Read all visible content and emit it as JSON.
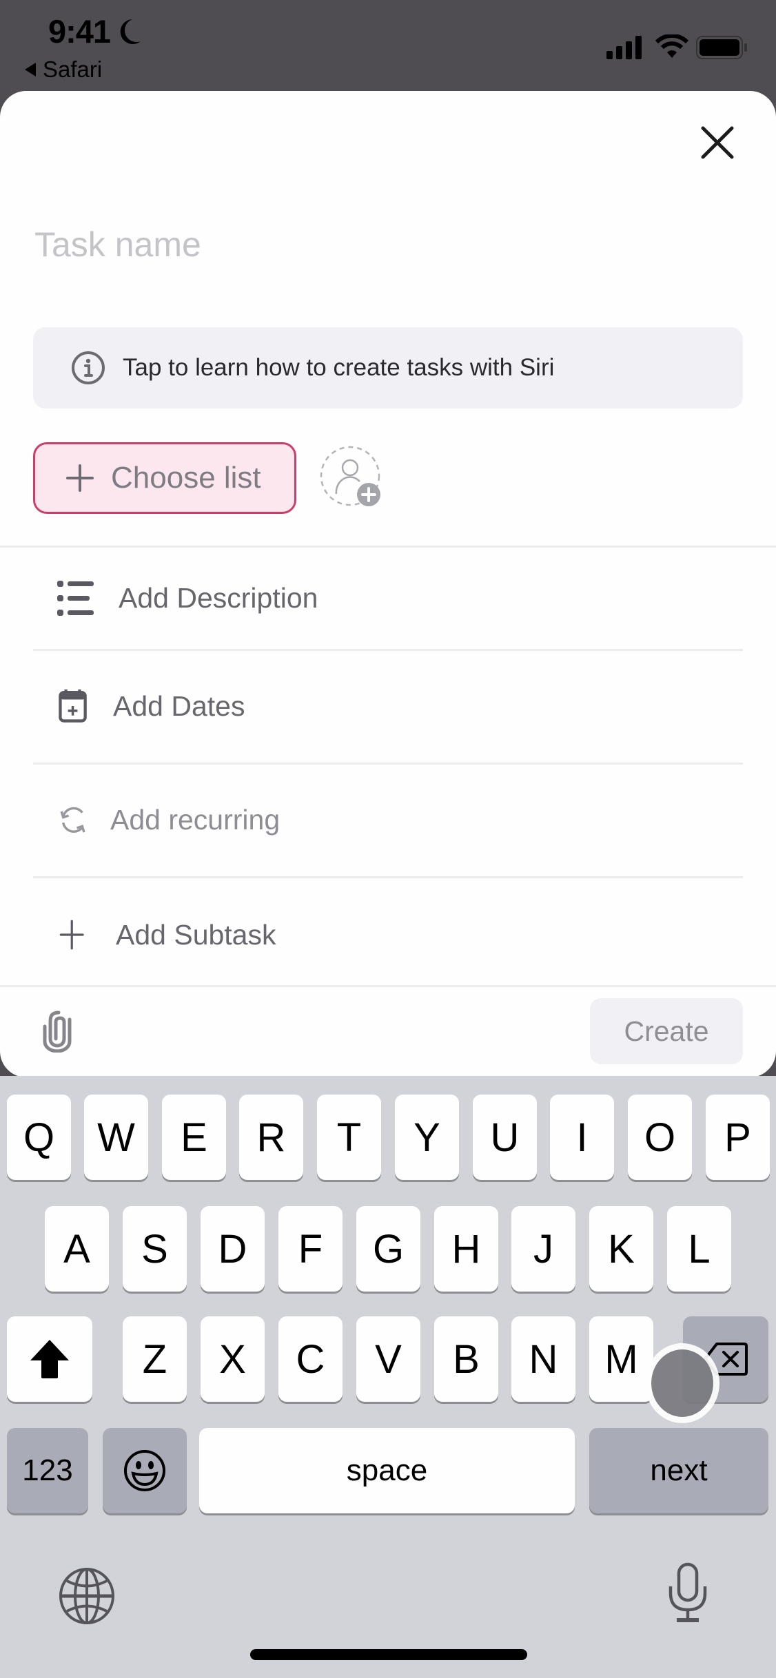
{
  "status_bar": {
    "time": "9:41",
    "focus_icon": "moon-icon",
    "back_app": "Safari",
    "icons": [
      "cellular-signal-icon",
      "wifi-icon",
      "battery-icon"
    ]
  },
  "sheet": {
    "close_icon": "close-icon",
    "task_name": {
      "value": "",
      "placeholder": "Task name"
    },
    "siri_banner": {
      "icon": "info-icon",
      "text": "Tap to learn how to create tasks with Siri"
    },
    "choose_list": {
      "icon": "plus-icon",
      "label": "Choose list",
      "accent_color": "#cc3e68",
      "bg_color": "#fde7ee"
    },
    "assignee": {
      "icon": "add-assignee-icon"
    },
    "rows": [
      {
        "icon": "description-list-icon",
        "label": "Add Description"
      },
      {
        "icon": "calendar-add-icon",
        "label": "Add Dates"
      },
      {
        "icon": "recurring-icon",
        "label": "Add recurring"
      },
      {
        "icon": "plus-icon",
        "label": "Add Subtask"
      }
    ],
    "footer": {
      "attach_icon": "paperclip-icon",
      "create_label": "Create"
    }
  },
  "keyboard": {
    "row1": [
      "Q",
      "W",
      "E",
      "R",
      "T",
      "Y",
      "U",
      "I",
      "O",
      "P"
    ],
    "row2": [
      "A",
      "S",
      "D",
      "F",
      "G",
      "H",
      "J",
      "K",
      "L"
    ],
    "row3": [
      "Z",
      "X",
      "C",
      "V",
      "B",
      "N",
      "M"
    ],
    "shift_icon": "shift-icon",
    "delete_icon": "delete-icon",
    "numbers_label": "123",
    "emoji_icon": "emoji-icon",
    "space_label": "space",
    "return_label": "next",
    "globe_icon": "globe-icon",
    "mic_icon": "microphone-icon"
  }
}
